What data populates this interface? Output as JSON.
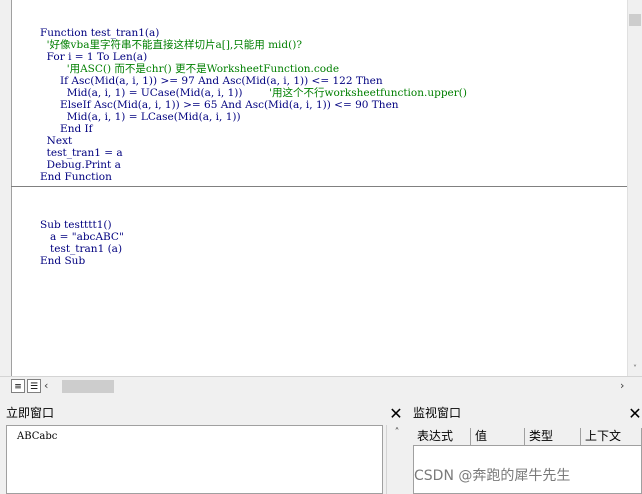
{
  "code_lines": [
    {
      "parts": [
        {
          "t": "Function test_tran1(a)",
          "c": "code"
        }
      ]
    },
    {
      "parts": [
        {
          "t": "  '好像vba里字符串不能直接这样切片a[],只能用 mid()?",
          "c": "comment"
        }
      ]
    },
    {
      "parts": [
        {
          "t": "  For i = 1 To Len(a)",
          "c": "code"
        }
      ]
    },
    {
      "parts": [
        {
          "t": "        '用ASC() 而不是chr() 更不是WorksheetFunction.code",
          "c": "comment"
        }
      ]
    },
    {
      "parts": [
        {
          "t": "      If Asc(Mid(a, i, 1)) >= 97 And Asc(Mid(a, i, 1)) <= 122 Then",
          "c": "code"
        }
      ]
    },
    {
      "parts": [
        {
          "t": "        Mid(a, i, 1) = UCase(Mid(a, i, 1))",
          "c": "code"
        },
        {
          "t": "        '用这个不行worksheetfunction.upper()",
          "c": "comment"
        }
      ]
    },
    {
      "parts": [
        {
          "t": "      ElseIf Asc(Mid(a, i, 1)) >= 65 And Asc(Mid(a, i, 1)) <= 90 Then",
          "c": "code"
        }
      ]
    },
    {
      "parts": [
        {
          "t": "        Mid(a, i, 1) = LCase(Mid(a, i, 1))",
          "c": "code"
        }
      ]
    },
    {
      "parts": [
        {
          "t": "      End If",
          "c": "code"
        }
      ]
    },
    {
      "parts": [
        {
          "t": "  Next",
          "c": "code"
        }
      ]
    },
    {
      "parts": [
        {
          "t": "  test_tran1 = a",
          "c": "code"
        }
      ]
    },
    {
      "parts": [
        {
          "t": "  Debug.Print a",
          "c": "code"
        }
      ]
    },
    {
      "parts": [
        {
          "t": "End Function",
          "c": "code"
        }
      ]
    },
    {
      "parts": [
        {
          "t": "",
          "c": "code"
        }
      ]
    },
    {
      "parts": [
        {
          "t": "",
          "c": "code"
        }
      ]
    },
    {
      "parts": [
        {
          "t": "",
          "c": "code"
        }
      ]
    },
    {
      "parts": [
        {
          "t": "Sub testttt1()",
          "c": "code"
        }
      ]
    },
    {
      "parts": [
        {
          "t": "   a = \"abcABC\"",
          "c": "code"
        }
      ]
    },
    {
      "parts": [
        {
          "t": "   test_tran1 (a)",
          "c": "code"
        }
      ]
    },
    {
      "parts": [
        {
          "t": "End Sub",
          "c": "code"
        }
      ]
    }
  ],
  "immediate": {
    "title": "立即窗口",
    "close": "✕",
    "output": "ABCabc"
  },
  "watch": {
    "title": "监视窗口",
    "close": "✕",
    "columns": [
      "表达式",
      "值",
      "类型",
      "上下文"
    ]
  },
  "scroll": {
    "left": "‹",
    "right": "›",
    "up": "˄",
    "down": "˅"
  },
  "view_buttons": {
    "procedure_view": "≡",
    "full_module_view": "☰"
  },
  "watermark": "CSDN @奔跑的犀牛先生",
  "colors": {
    "keyword_code": "#00007f",
    "comment": "#007f00"
  }
}
